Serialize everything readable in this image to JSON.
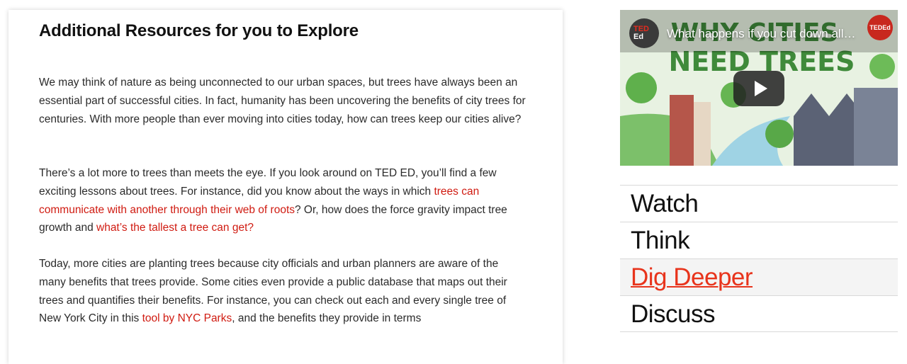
{
  "article": {
    "heading": "Additional Resources for you to Explore",
    "p1": "We may think of nature as being unconnected to our urban spaces, but trees have always been an essential part of successful cities. In fact, humanity has been uncovering the benefits of city trees for centuries. With more people than ever moving into cities today, how can trees keep our cities alive?",
    "p2_a": "There’s a lot more to trees than meets the eye. If you look around on TED ED, you’ll find a few exciting lessons about trees. For instance, did you know about the ways in which ",
    "p2_link1": "trees can communicate with another through their web of roots",
    "p2_b": "? Or, how does the force gravity impact tree growth and ",
    "p2_link2": "what’s the tallest a tree can get?",
    "p3_a": "Today, more cities are planting trees because city officials and urban planners are aware of the many benefits that trees provide. Some cities even provide a public database that maps out their trees and quantifies their benefits. For instance, you can check out each and every single tree of New York City in this ",
    "p3_link": "tool by NYC Parks",
    "p3_b": ", and the benefits they provide in terms"
  },
  "video": {
    "logo_line1": "TED",
    "logo_line2": "Ed",
    "title": "What happens if you cut down all of a city's trees?",
    "channel": "TEDEd",
    "thumb_text_1": "WHY CITIES",
    "thumb_text_2": "NEED TREES",
    "play_icon": "play-icon"
  },
  "nav": {
    "items": [
      {
        "label": "Watch"
      },
      {
        "label": "Think"
      },
      {
        "label": "Dig Deeper"
      },
      {
        "label": "Discuss"
      }
    ],
    "active_index": 2
  },
  "colors": {
    "link": "#d01b11",
    "active_nav": "#e8341c"
  }
}
